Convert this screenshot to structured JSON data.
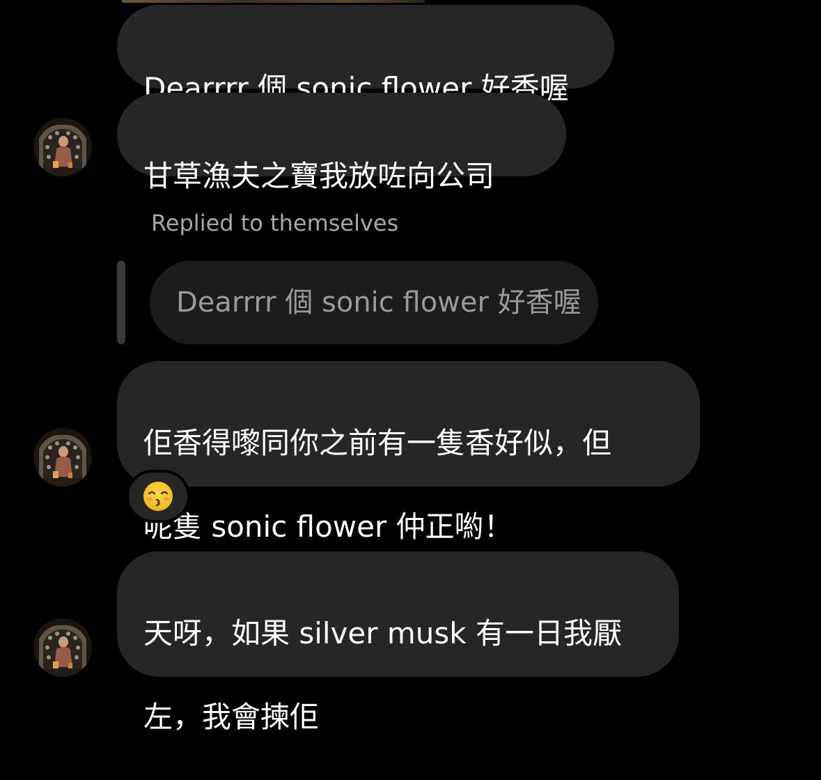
{
  "thread": {
    "messages": [
      {
        "text": "Dearrrr 個 sonic flower 好香喔"
      },
      {
        "text": "甘草漁夫之寶我放咗向公司"
      },
      {
        "reply_label": "Replied to themselves",
        "quoted_text": "Dearrrr 個 sonic flower 好香喔",
        "line1": "佢香得嚟同你之前有一隻香好似，但",
        "line2": "呢隻 sonic flower 仲正喲！",
        "reaction": "kissing-face-with-closed-eyes-emoji"
      },
      {
        "line1": "天呀，如果 silver musk 有一日我厭",
        "line2": "左，我會揀佢"
      }
    ]
  },
  "colors": {
    "background": "#000000",
    "bubble": "#262626",
    "quoted_bubble": "#1c1c1c",
    "muted_text": "#a8a8a8",
    "reply_bar": "#3a3a3a",
    "emoji_yellow": "#f7c531"
  },
  "icons": {
    "avatar": "profile-photo-avatar",
    "reaction": "kissing-face-emoji"
  }
}
